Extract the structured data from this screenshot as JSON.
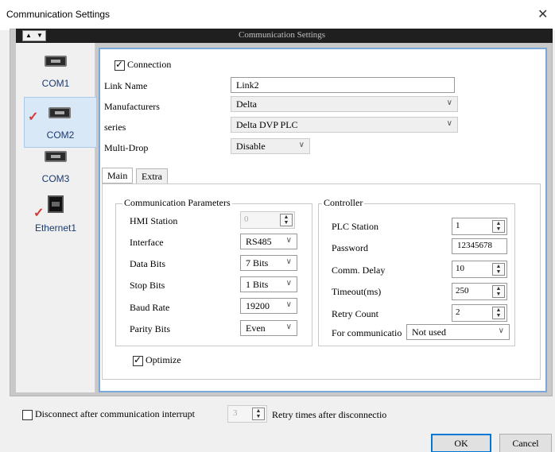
{
  "window": {
    "title": "Communication Settings",
    "close_glyph": "✕"
  },
  "header": {
    "title": "Communication Settings",
    "scroll_up": "▲",
    "scroll_down": "▼"
  },
  "sidebar": {
    "items": [
      {
        "label": "COM1",
        "icon": "serial-port-icon",
        "checked": false,
        "active": false
      },
      {
        "label": "COM2",
        "icon": "serial-port-icon",
        "checked": true,
        "active": true
      },
      {
        "label": "COM3",
        "icon": "serial-port-icon",
        "checked": false,
        "active": false
      },
      {
        "label": "Ethernet1",
        "icon": "ethernet-port-icon",
        "checked": true,
        "active": false
      }
    ],
    "check_glyph": "✓"
  },
  "connection": {
    "checkbox_label": "Connection",
    "checked": true,
    "link_name_label": "Link Name",
    "link_name_value": "Link2",
    "manufacturers_label": "Manufacturers",
    "manufacturers_value": "Delta",
    "series_label": "series",
    "series_value": "Delta DVP PLC",
    "multidrop_label": "Multi-Drop",
    "multidrop_value": "Disable"
  },
  "tabs": [
    {
      "label": "Main",
      "active": true
    },
    {
      "label": "Extra",
      "active": false
    }
  ],
  "comm_params": {
    "legend": "Communication Parameters",
    "hmi_station_label": "HMI Station",
    "hmi_station_value": "0",
    "interface_label": "Interface",
    "interface_value": "RS485",
    "data_bits_label": "Data Bits",
    "data_bits_value": "7 Bits",
    "stop_bits_label": "Stop Bits",
    "stop_bits_value": "1 Bits",
    "baud_rate_label": "Baud Rate",
    "baud_rate_value": "19200",
    "parity_bits_label": "Parity Bits",
    "parity_bits_value": "Even"
  },
  "controller": {
    "legend": "Controller",
    "plc_station_label": "PLC Station",
    "plc_station_value": "1",
    "password_label": "Password",
    "password_value": "12345678",
    "comm_delay_label": "Comm. Delay",
    "comm_delay_value": "10",
    "timeout_label": "Timeout(ms)",
    "timeout_value": "250",
    "retry_count_label": "Retry Count",
    "retry_count_value": "2",
    "for_comm_label": "For communicatio",
    "for_comm_value": "Not used"
  },
  "optimize": {
    "label": "Optimize",
    "checked": true
  },
  "footer": {
    "disconnect_label": "Disconnect after communication interrupt",
    "disconnect_checked": false,
    "retry_value": "3",
    "retry_label": "Retry times after disconnectio",
    "ok_label": "OK",
    "cancel_label": "Cancel"
  },
  "glyphs": {
    "chevron_down": "∨",
    "spin_up": "▲",
    "spin_down": "▼"
  },
  "colors": {
    "accent": "#0078d7",
    "panel_border": "#7aa8d8",
    "check": "#d23a3a",
    "active_tab_bg": "#d9e8f7"
  }
}
